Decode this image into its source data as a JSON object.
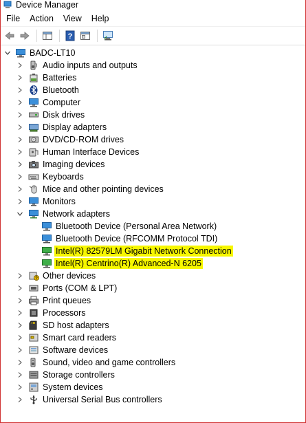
{
  "window": {
    "title": "Device Manager"
  },
  "menu": [
    "File",
    "Action",
    "View",
    "Help"
  ],
  "toolbar": {
    "buttons": [
      "back-icon",
      "forward-icon",
      "show-hide-tree-icon",
      "help-icon",
      "properties-icon",
      "scan-hardware-icon"
    ]
  },
  "tree": {
    "root": "BADC-LT10",
    "categories": [
      {
        "label": "Audio inputs and outputs",
        "icon": "audio-icon",
        "expanded": false
      },
      {
        "label": "Batteries",
        "icon": "battery-icon",
        "expanded": false
      },
      {
        "label": "Bluetooth",
        "icon": "bluetooth-icon",
        "expanded": false
      },
      {
        "label": "Computer",
        "icon": "computer-icon",
        "expanded": false
      },
      {
        "label": "Disk drives",
        "icon": "disk-drive-icon",
        "expanded": false
      },
      {
        "label": "Display adapters",
        "icon": "display-adapter-icon",
        "expanded": false
      },
      {
        "label": "DVD/CD-ROM drives",
        "icon": "dvd-icon",
        "expanded": false
      },
      {
        "label": "Human Interface Devices",
        "icon": "hid-icon",
        "expanded": false
      },
      {
        "label": "Imaging devices",
        "icon": "camera-icon",
        "expanded": false
      },
      {
        "label": "Keyboards",
        "icon": "keyboard-icon",
        "expanded": false
      },
      {
        "label": "Mice and other pointing devices",
        "icon": "mouse-icon",
        "expanded": false
      },
      {
        "label": "Monitors",
        "icon": "monitor-icon",
        "expanded": false
      },
      {
        "label": "Network adapters",
        "icon": "network-adapter-icon",
        "expanded": true
      },
      {
        "label": "Other devices",
        "icon": "unknown-device-icon",
        "expanded": false
      },
      {
        "label": "Ports (COM & LPT)",
        "icon": "port-icon",
        "expanded": false
      },
      {
        "label": "Print queues",
        "icon": "printer-icon",
        "expanded": false
      },
      {
        "label": "Processors",
        "icon": "processor-icon",
        "expanded": false
      },
      {
        "label": "SD host adapters",
        "icon": "sd-card-icon",
        "expanded": false
      },
      {
        "label": "Smart card readers",
        "icon": "smart-card-icon",
        "expanded": false
      },
      {
        "label": "Software devices",
        "icon": "software-device-icon",
        "expanded": false
      },
      {
        "label": "Sound, video and game controllers",
        "icon": "sound-icon",
        "expanded": false
      },
      {
        "label": "Storage controllers",
        "icon": "storage-icon",
        "expanded": false
      },
      {
        "label": "System devices",
        "icon": "system-device-icon",
        "expanded": false
      },
      {
        "label": "Universal Serial Bus controllers",
        "icon": "usb-icon",
        "expanded": false
      }
    ],
    "network_adapters": [
      {
        "label": "Bluetooth Device (Personal Area Network)",
        "highlighted": false
      },
      {
        "label": "Bluetooth Device (RFCOMM Protocol TDI)",
        "highlighted": false
      },
      {
        "label": "Intel(R) 82579LM Gigabit Network Connection",
        "highlighted": true
      },
      {
        "label": "Intel(R) Centrino(R) Advanced-N 6205",
        "highlighted": true
      }
    ]
  },
  "colors": {
    "highlight": "#f7f700",
    "window_border": "#d03030"
  }
}
